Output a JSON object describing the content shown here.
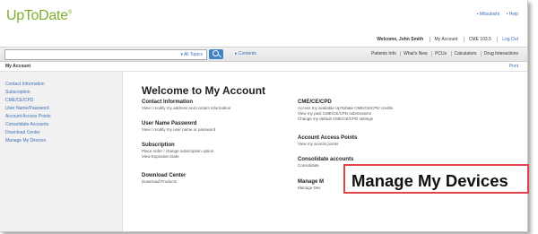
{
  "header": {
    "logo": "UpToDate",
    "logo_mark": "®",
    "links": [
      "• Mitsubishi",
      "• Help"
    ]
  },
  "userbar": {
    "welcome": "Welcome, John Smith",
    "items": [
      "My Account",
      "CME 103.5"
    ],
    "logout": "Log Out"
  },
  "search": {
    "placeholder": "",
    "scope": "▾ All Topics",
    "contents": "▸ Contents",
    "nav": [
      "Patients Info",
      "What's New",
      "PCUs",
      "Calculators",
      "Drug Interactions"
    ]
  },
  "breadcrumb": {
    "label": "My Account",
    "print": "Print"
  },
  "sidebar": {
    "items": [
      "Contact Information",
      "Subscription",
      "CME/CE/CPD",
      "User Name/Password",
      "Account Access Points",
      "Consolidate Accounts",
      "Download Center",
      "Manage My Devices"
    ]
  },
  "main": {
    "title": "Welcome to My Account",
    "left": [
      {
        "title": "Contact Information",
        "desc": [
          "View / modify my address and contact information"
        ]
      },
      {
        "title": "User Name Password",
        "desc": [
          "View / modify my user name or password"
        ]
      },
      {
        "title": "Subscription",
        "desc": [
          "Place order / change subscription option",
          "View Expiration Date"
        ]
      },
      {
        "title": "Download Center",
        "desc": [
          "Download Products"
        ]
      }
    ],
    "right": [
      {
        "title": "CME/CE/CPD",
        "desc": [
          "Access my available UpToDate CME/CE/CPD credits",
          "View my past CME/CE/CPD submissions",
          "Change my default CME/CE/CPD settings"
        ]
      },
      {
        "title": "Account Access Points",
        "desc": [
          "View my access points"
        ]
      },
      {
        "title": "Consolidate accounts",
        "desc": [
          "Consolidate"
        ]
      },
      {
        "title": "Manage M",
        "desc": [
          "Manage Dev"
        ]
      }
    ]
  },
  "callout": {
    "text": "Manage My Devices",
    "border_color": "#e0444b"
  }
}
